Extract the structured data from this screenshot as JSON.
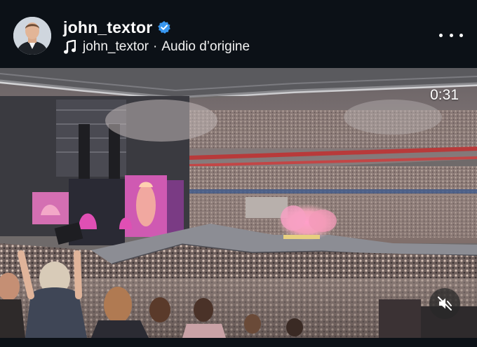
{
  "post": {
    "username": "john_textor",
    "verified": true,
    "audio": {
      "user": "john_textor",
      "separator": "·",
      "label": "Audio d’origine"
    }
  },
  "video": {
    "elapsed": "0:31",
    "muted": true
  },
  "icons": {
    "verified": "verified-badge-icon",
    "audio": "music-note-icon",
    "more": "more-options-icon",
    "mute": "speaker-muted-icon"
  },
  "colors": {
    "background": "#0c1117",
    "verified": "#3897f0"
  }
}
